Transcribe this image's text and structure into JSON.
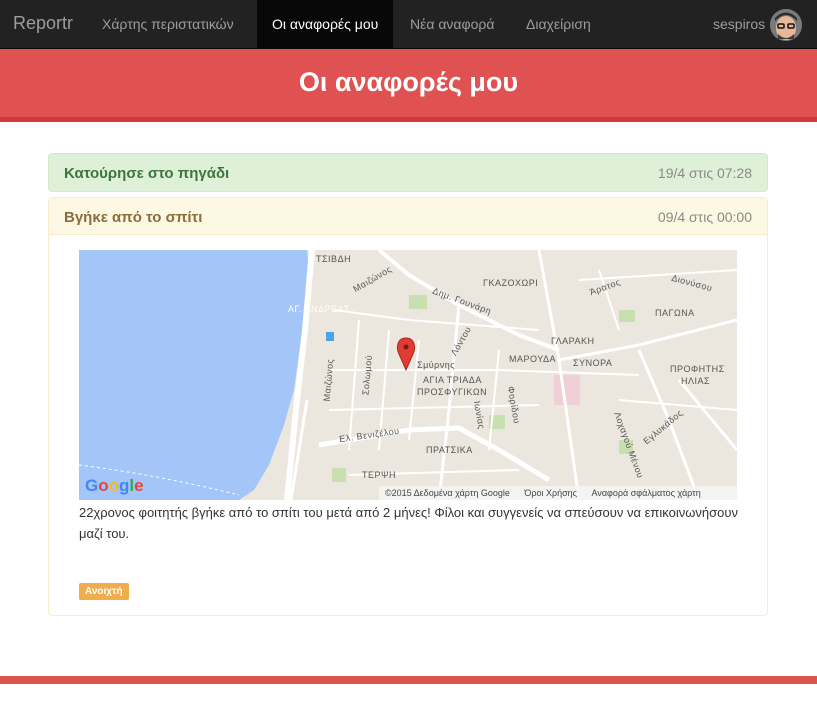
{
  "navbar": {
    "brand": "Reportr",
    "items": [
      {
        "label": "Χάρτης περιστατικών",
        "active": false
      },
      {
        "label": "Οι αναφορές μου",
        "active": true
      },
      {
        "label": "Νέα αναφορά",
        "active": false
      },
      {
        "label": "Διαχείριση",
        "active": false
      }
    ],
    "user": "sespiros"
  },
  "header": {
    "title": "Οι αναφορές μου"
  },
  "reports": [
    {
      "title": "Κατούρησε στο πηγάδι",
      "date": "19/4 στις 07:28",
      "state": "success"
    },
    {
      "title": "Βγήκε από το σπίτι",
      "date": "09/4 στις 00:00",
      "state": "warning",
      "description": "22χρονος φοιτητής βγήκε από το σπίτι του μετά από 2 μήνες! Φίλοι και συγγενείς να σπεύσουν να επικοινωνήσουν μαζί του.",
      "status": "Ανοιχτή",
      "map": {
        "labels": {
          "tsivdi": "ΤΣΙΒΔΗ",
          "ag_andreas": "ΑΓ. ΑΝΔΡΕΑΣ",
          "gkazochori": "ΓΚΑΖΟΧΩΡΙ",
          "dim_gounari": "Δημ. Γουνάρη",
          "glaraki": "ΓΛΑΡΑΚΗ",
          "marouda": "ΜΑΡΟΥΔΑ",
          "synora": "ΣΥΝΟΡΑ",
          "agia_triada_1": "ΑΓΙΑ ΤΡΙΑΔΑ",
          "agia_triada_2": "ΠΡΟΣΦΥΓΙΚΩΝ",
          "smyrnis": "Σμύρνης",
          "el_venizelou": "Ελ. Βενιζέλου",
          "pratsika": "ΠΡΑΤΣΙΚΑ",
          "terpsi": "ΤΕΡΨΗ",
          "pagona": "ΠΑΓΩΝΑ",
          "profitis_1": "ΠΡΟΦΗΤΗΣ",
          "profitis_2": "ΗΛΙΑΣ",
          "maizonos_1": "Μαιζώνος",
          "maizonos_2": "Μαιζώνος",
          "solomou": "Σολωμού",
          "lontou": "Λόντου",
          "dionysou": "Διονύσου",
          "aratou": "Άρατος",
          "eglykados": "Εγλυκάδος",
          "lochagou_menou": "Λοχαγού Μένου",
          "ionias": "Ιωνίας",
          "poridafou": "Φορίδου"
        },
        "attribution": "©2015 Δεδομένα χάρτη Google",
        "terms": "Όροι Χρήσης",
        "report_error": "Αναφορά σφάλματος χάρτη",
        "logo": "Google",
        "colors": {
          "water": "#a4c5f8",
          "land": "#ebe6de",
          "road": "#ffffff",
          "park": "#c9dfaf",
          "marker": "#e03c31"
        }
      }
    }
  ],
  "colors": {
    "navbar": "#222222",
    "header": "#e05252",
    "footer": "#d9534f",
    "badge": "#f0ad4e"
  }
}
